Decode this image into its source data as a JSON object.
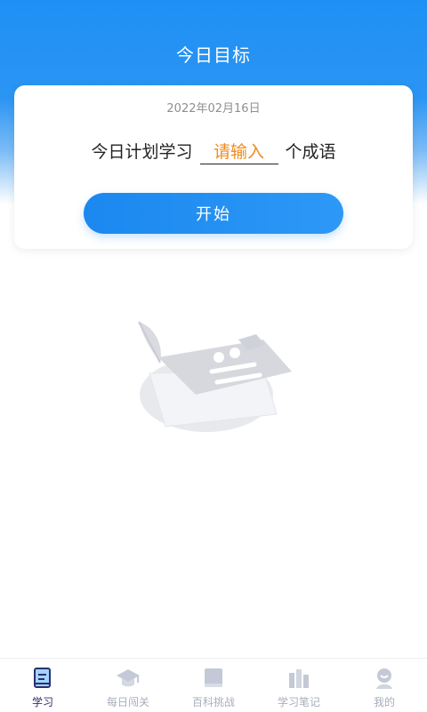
{
  "header": {
    "title": "今日目标"
  },
  "goal_card": {
    "date": "2022年02月16日",
    "plan_prefix": "今日计划学习",
    "input_placeholder": "请输入",
    "input_value": "",
    "plan_suffix": "个成语",
    "start_label": "开始"
  },
  "empty_state": {
    "icon": "notebook-clipboard-illustration"
  },
  "tabbar": {
    "active_index": 0,
    "items": [
      {
        "label": "学习",
        "icon": "book-icon"
      },
      {
        "label": "每日闯关",
        "icon": "graduation-cap-icon"
      },
      {
        "label": "百科挑战",
        "icon": "encyclopedia-book-icon"
      },
      {
        "label": "学习笔记",
        "icon": "books-icon"
      },
      {
        "label": "我的",
        "icon": "user-icon"
      }
    ]
  },
  "colors": {
    "primary": "#1e90f5",
    "accent_orange": "#f08a1c",
    "tab_inactive": "#a8aebb",
    "tab_active": "#2e2e6e"
  }
}
